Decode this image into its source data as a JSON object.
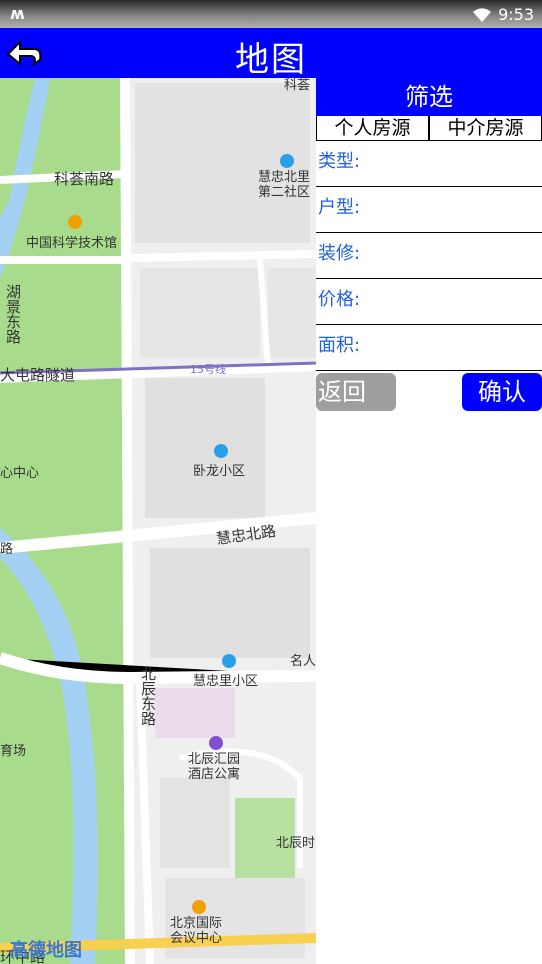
{
  "status_bar": {
    "left_icon": "m-logo",
    "time": "9:53",
    "wifi_icon": "wifi-icon"
  },
  "app_bar": {
    "title": "地图",
    "back_icon": "back-icon"
  },
  "map": {
    "labels": {
      "top_partial": "科荟",
      "kehui_south_road": "科荟南路",
      "huizhong_beili_2": "慧忠北里\n第二社区",
      "museum": "中国科学技术馆",
      "hujing_east_road": "湖景东路",
      "datun_tunnel": "大屯路隧道",
      "line15": "15号线",
      "center_partial": "心中心",
      "wolong": "卧龙小区",
      "huizhong_north_road": "慧忠北路",
      "road_partial": "路",
      "mingren": "名人",
      "huizhongli": "慧忠里小区",
      "beichen_east_road": "北辰东路",
      "stadium_partial": "育场",
      "beichen_hotel": "北辰汇园\n酒店公寓",
      "beichen_shi": "北辰时",
      "conference_center": "北京国际\n会议中心",
      "ring_partial": "环中路",
      "amap_logo": "高德地图"
    }
  },
  "filter_panel": {
    "title": "筛选",
    "tabs": [
      "个人房源",
      "中介房源"
    ],
    "fields": [
      "类型:",
      "户型:",
      "装修:",
      "价格:",
      "面积:"
    ],
    "back_button": "返回",
    "confirm_button": "确认"
  }
}
